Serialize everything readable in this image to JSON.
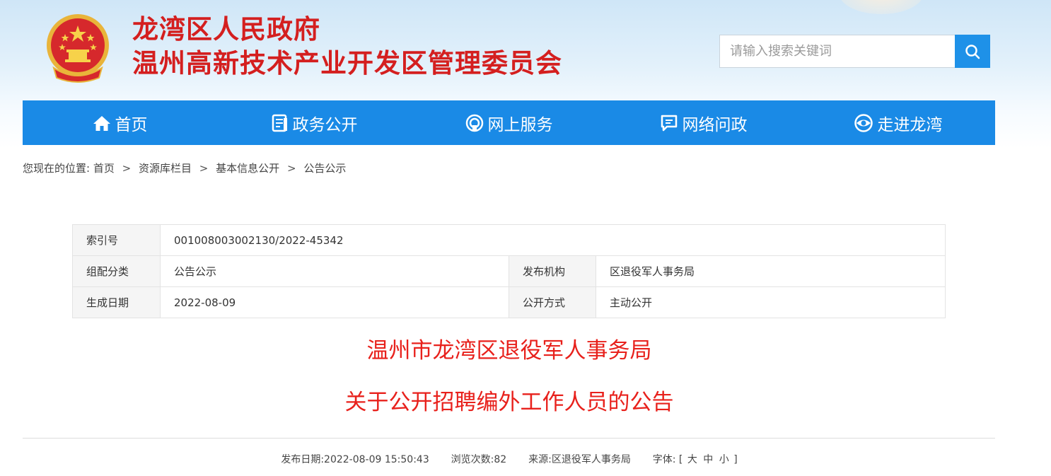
{
  "header": {
    "title_line1": "龙湾区人民政府",
    "title_line2": "温州高新技术产业开发区管理委员会",
    "emblem_icon": "national-emblem-icon",
    "brand_red": "#d41f1f"
  },
  "search": {
    "placeholder": "请输入搜索关键词",
    "button_icon": "search-icon",
    "button_color": "#1e91e8"
  },
  "nav": {
    "color": "#1a8ae6",
    "items": [
      {
        "label": "首页",
        "icon": "home-icon"
      },
      {
        "label": "政务公开",
        "icon": "document-icon"
      },
      {
        "label": "网上服务",
        "icon": "service-icon"
      },
      {
        "label": "网络问政",
        "icon": "chat-icon"
      },
      {
        "label": "走进龙湾",
        "icon": "eye-icon"
      }
    ]
  },
  "breadcrumb": {
    "prefix": "您现在的位置:",
    "items": [
      "首页",
      "资源库栏目",
      "基本信息公开",
      "公告公示"
    ],
    "separator": ">"
  },
  "meta": {
    "index_label": "索引号",
    "index_value": "001008003002130/2022-45342",
    "category_label": "组配分类",
    "category_value": "公告公示",
    "publisher_label": "发布机构",
    "publisher_value": "区退役军人事务局",
    "date_label": "生成日期",
    "date_value": "2022-08-09",
    "method_label": "公开方式",
    "method_value": "主动公开"
  },
  "article": {
    "title_line1": "温州市龙湾区退役军人事务局",
    "title_line2": "关于公开招聘编外工作人员的公告",
    "title_color": "#e8211c"
  },
  "info": {
    "publish_label": "发布日期:",
    "publish_value": "2022-08-09 15:50:43",
    "views_label": "浏览次数:",
    "views_value": "82",
    "source_label": "来源:",
    "source_value": "区退役军人事务局",
    "font_label": "字体:",
    "font_open": "[",
    "font_large": "大",
    "font_medium": "中",
    "font_small": "小",
    "font_close": "]"
  }
}
